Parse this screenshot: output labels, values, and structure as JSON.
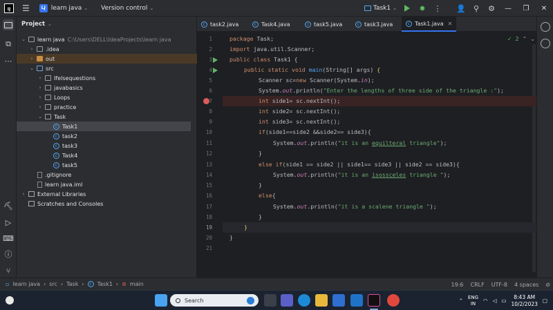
{
  "titlebar": {
    "project_badge": "LJ",
    "project_name": "learn java",
    "vcs": "Version control",
    "run_config": "Task1"
  },
  "project_panel": {
    "title": "Project",
    "root_name": "learn java",
    "root_path": "C:\\Users\\DELL\\IdeaProjects\\learn java",
    "items": {
      "idea": ".idea",
      "out": "out",
      "src": "src",
      "ifelse": "Ifelsequestions",
      "javabasics": "javabasics",
      "loops": "Loops",
      "practice": "practice",
      "task": "Task",
      "task1": "Task1",
      "task2": "task2",
      "task3": "task3",
      "task4": "Task4",
      "task5": "task5",
      "gitignore": ".gitignore",
      "iml": "learn java.iml",
      "extlibs": "External Libraries",
      "scratches": "Scratches and Consoles"
    }
  },
  "tabs": [
    "task2.java",
    "Task4.java",
    "task5.java",
    "task3.java",
    "Task1.java"
  ],
  "editor": {
    "warnings": "2",
    "line_numbers": [
      "1",
      "2",
      "3",
      "4",
      "5",
      "6",
      "7",
      "8",
      "9",
      "10",
      "11",
      "12",
      "13",
      "14",
      "15",
      "16",
      "17",
      "18",
      "19",
      "20",
      "21"
    ],
    "code": {
      "l1a": "package",
      "l1b": " Task;",
      "l2a": "import",
      "l2b": " java.util.Scanner;",
      "l3a": "public class",
      "l3b": " Task1 {",
      "l4a": "public static void",
      "l4b": "main",
      "l4c": "(String[] args) ",
      "l4d": "{",
      "l5a": "Scanner sc=",
      "l5b": "new",
      "l5c": " Scanner(System.",
      "l5d": "in",
      "l5e": ");",
      "l6a": "System.",
      "l6b": "out",
      "l6c": ".println(",
      "l6d": "\"Enter the lengths of three side of the triangle :\"",
      "l6e": ");",
      "l7a": "int",
      "l7b": " side1= sc.nextInt();",
      "l8a": "int",
      "l8b": " side2= sc.nextInt();",
      "l9a": "int",
      "l9b": " side3= sc.nextInt();",
      "l10a": "if",
      "l10b": "(side1==side2 &&side2== side3){",
      "l11a": "System.",
      "l11b": "out",
      "l11c": ".println(",
      "l11d": "\"it is an ",
      "l11e": "equilteral",
      "l11f": " triangle\"",
      "l11g": ");",
      "l12": "}",
      "l13a": "else if",
      "l13b": "(side1 == side2 || side1== side3 || side2 == side3){",
      "l14a": "System.",
      "l14b": "out",
      "l14c": ".println(",
      "l14d": "\"it is an ",
      "l14e": "isossceles",
      "l14f": " triangle \"",
      "l14g": ");",
      "l15": "}",
      "l16a": "else",
      "l16b": "{",
      "l17a": "System.",
      "l17b": "out",
      "l17c": ".println(",
      "l17d": "\"it is a scalene triangle \"",
      "l17e": ");",
      "l18": "}",
      "l19": "}",
      "l20": "}"
    }
  },
  "statusbar": {
    "crumbs": [
      "learn java",
      "src",
      "Task",
      "Task1",
      "main"
    ],
    "position": "19:6",
    "line_sep": "CRLF",
    "encoding": "UTF-8",
    "indent": "4 spaces"
  },
  "taskbar": {
    "search": "Search",
    "lang1": "ENG",
    "lang2": "IN",
    "time": "8:43 AM",
    "date": "10/2/2023"
  },
  "colors": {
    "accent": "#3574f0",
    "run_green": "#5fb865",
    "breakpoint": "#db5c5c",
    "keyword": "#cf8e6d",
    "string": "#6aab73",
    "method": "#56a8f5",
    "static_field": "#c77dbb"
  },
  "icons": [
    "main-menu-icon",
    "run-icon",
    "debug-icon",
    "more-icon",
    "add-user-icon",
    "search-icon",
    "settings-icon",
    "minimize-icon",
    "maximize-icon",
    "close-icon",
    "project-folder-icon",
    "structure-icon",
    "breakpoint-icon",
    "notifications-icon",
    "ai-icon"
  ]
}
